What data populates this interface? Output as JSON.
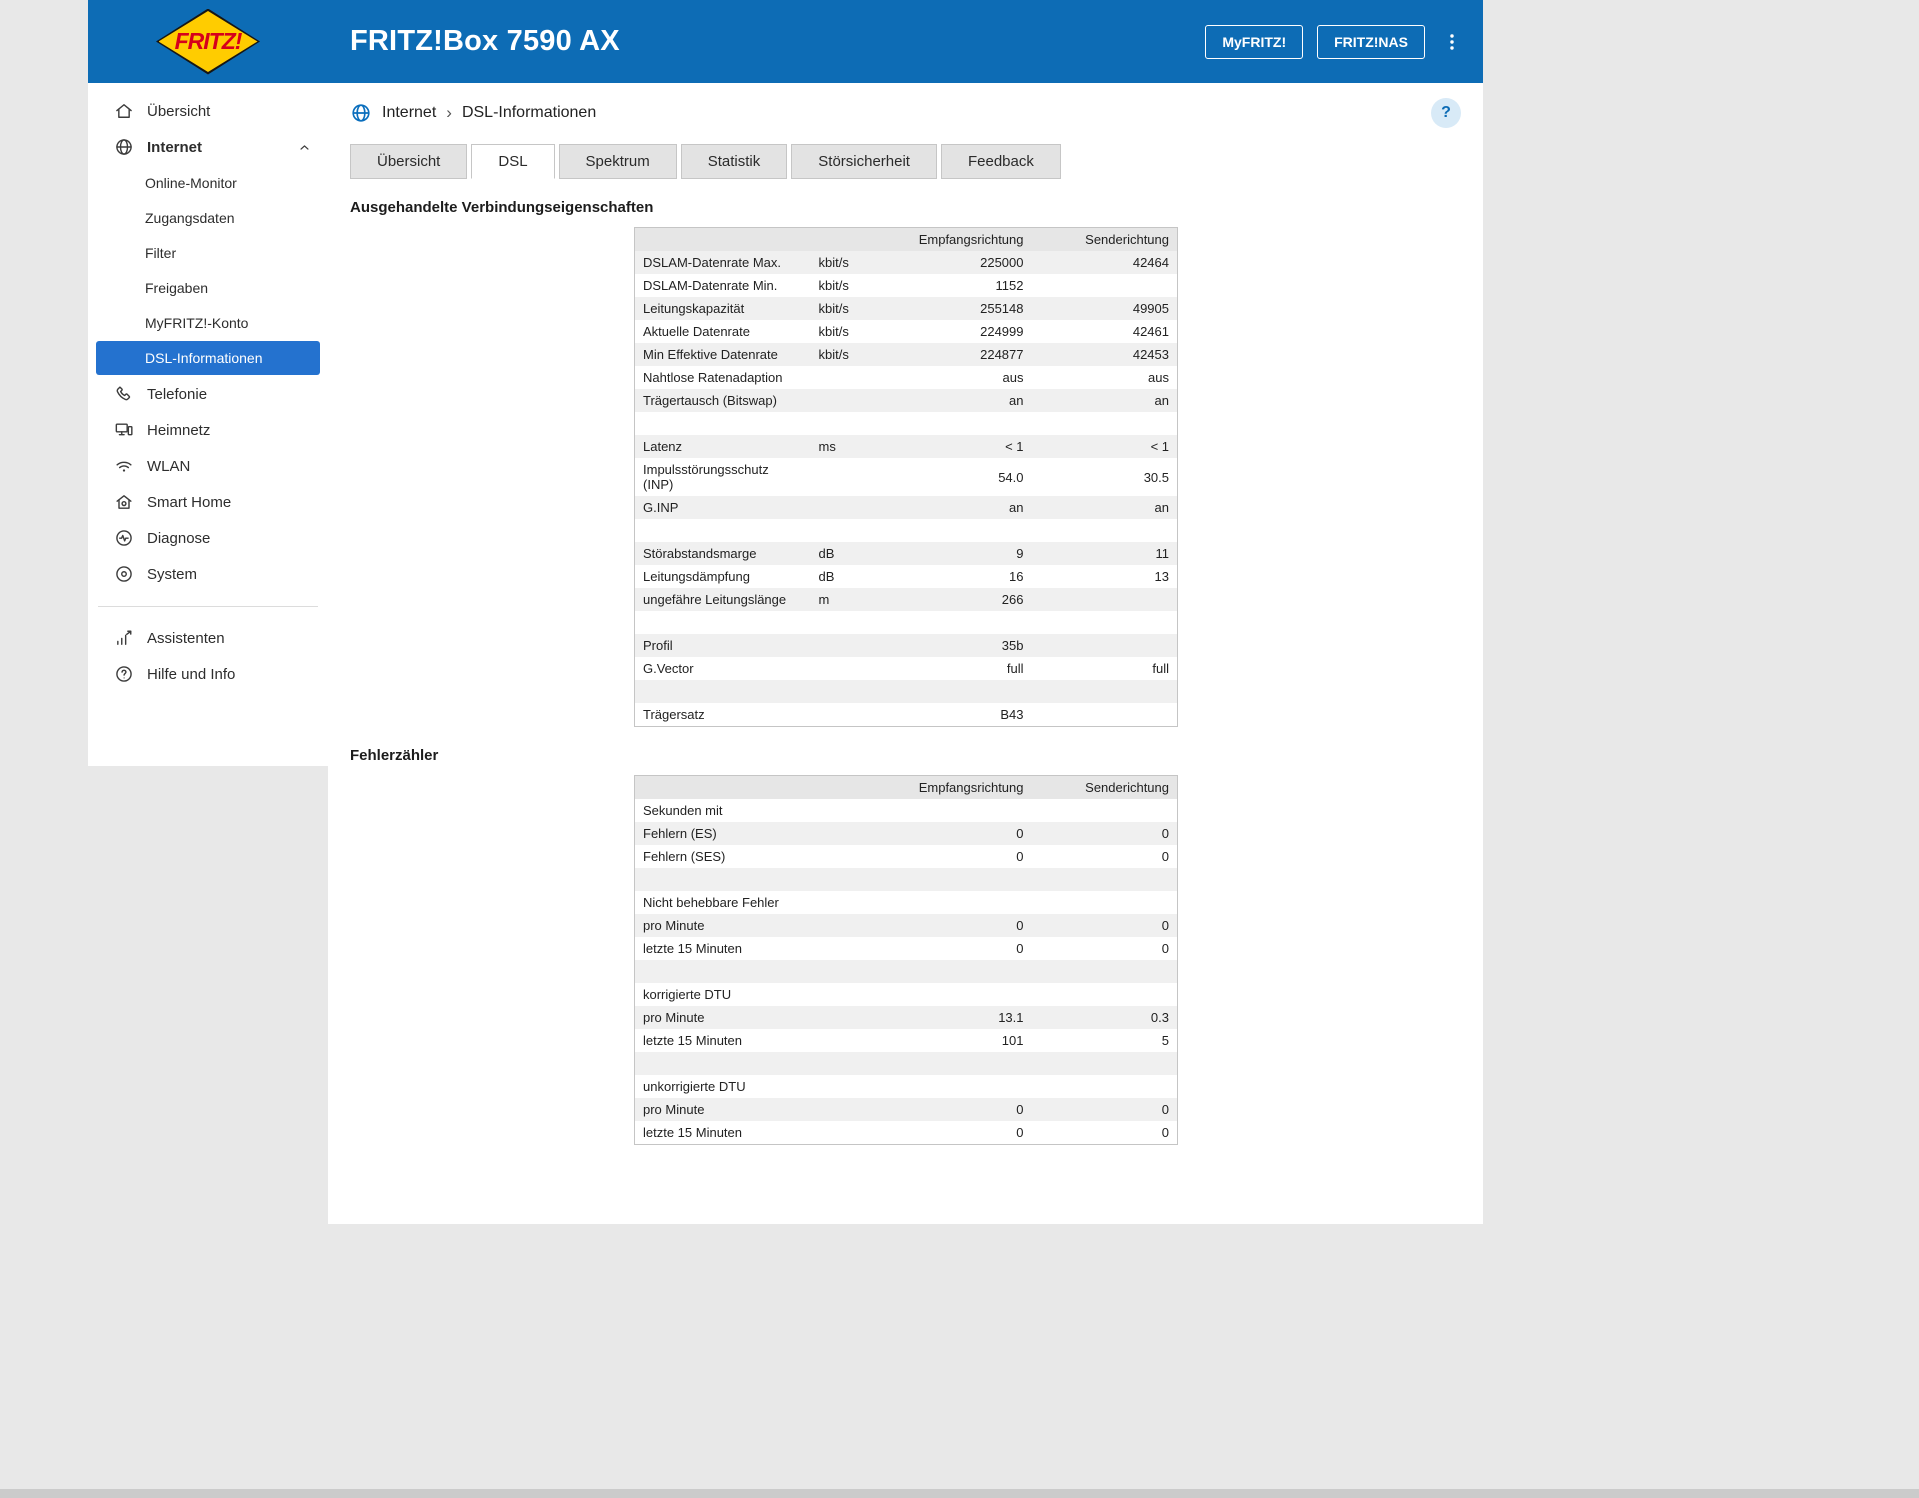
{
  "header": {
    "logo_text": "FRITZ!",
    "title": "FRITZ!Box 7590 AX",
    "actions": [
      {
        "label": "MyFRITZ!"
      },
      {
        "label": "FRITZ!NAS"
      }
    ],
    "menu_icon": "kebab-menu-icon"
  },
  "sidebar": {
    "items": [
      {
        "label": "Übersicht",
        "icon": "home-icon"
      },
      {
        "label": "Internet",
        "icon": "globe-icon",
        "bold": true,
        "expanded": true,
        "children": [
          {
            "label": "Online-Monitor"
          },
          {
            "label": "Zugangsdaten"
          },
          {
            "label": "Filter"
          },
          {
            "label": "Freigaben"
          },
          {
            "label": "MyFRITZ!-Konto"
          },
          {
            "label": "DSL-Informationen",
            "selected": true
          }
        ]
      },
      {
        "label": "Telefonie",
        "icon": "phone-icon"
      },
      {
        "label": "Heimnetz",
        "icon": "devices-icon"
      },
      {
        "label": "WLAN",
        "icon": "wifi-icon"
      },
      {
        "label": "Smart Home",
        "icon": "smart-home-icon"
      },
      {
        "label": "Diagnose",
        "icon": "diagnose-icon"
      },
      {
        "label": "System",
        "icon": "system-icon"
      },
      {
        "divider": true
      },
      {
        "label": "Assistenten",
        "icon": "assistant-icon"
      },
      {
        "label": "Hilfe und Info",
        "icon": "help-icon"
      }
    ]
  },
  "breadcrumb": {
    "icon": "globe-blue-icon",
    "items": [
      "Internet",
      "DSL-Informationen"
    ],
    "separator": "›",
    "help_text": "?"
  },
  "tabs": {
    "active": "DSL",
    "items": [
      "Übersicht",
      "DSL",
      "Spektrum",
      "Statistik",
      "Störsicherheit",
      "Feedback"
    ]
  },
  "connection_section": {
    "title": "Ausgehandelte Verbindungseigenschaften",
    "columns": {
      "rx": "Empfangsrichtung",
      "tx": "Senderichtung"
    },
    "rows": [
      {
        "label": "DSLAM-Datenrate Max.",
        "unit": "kbit/s",
        "rx": "225000",
        "tx": "42464"
      },
      {
        "label": "DSLAM-Datenrate Min.",
        "unit": "kbit/s",
        "rx": "1152",
        "tx": ""
      },
      {
        "label": "Leitungskapazität",
        "unit": "kbit/s",
        "rx": "255148",
        "tx": "49905"
      },
      {
        "label": "Aktuelle Datenrate",
        "unit": "kbit/s",
        "rx": "224999",
        "tx": "42461"
      },
      {
        "label": "Min Effektive Datenrate",
        "unit": "kbit/s",
        "rx": "224877",
        "tx": "42453"
      },
      {
        "label": "Nahtlose Ratenadaption",
        "unit": "",
        "rx": "aus",
        "tx": "aus"
      },
      {
        "label": "Trägertausch (Bitswap)",
        "unit": "",
        "rx": "an",
        "tx": "an"
      },
      {
        "spacer": true
      },
      {
        "label": "Latenz",
        "unit": "ms",
        "rx": "< 1",
        "tx": "< 1"
      },
      {
        "label": "Impulsstörungsschutz (INP)",
        "unit": "",
        "rx": "54.0",
        "tx": "30.5"
      },
      {
        "label": "G.INP",
        "unit": "",
        "rx": "an",
        "tx": "an"
      },
      {
        "spacer": true
      },
      {
        "label": "Störabstandsmarge",
        "unit": "dB",
        "rx": "9",
        "tx": "11"
      },
      {
        "label": "Leitungsdämpfung",
        "unit": "dB",
        "rx": "16",
        "tx": "13"
      },
      {
        "label": "ungefähre Leitungslänge",
        "unit": "m",
        "rx": "266",
        "tx": ""
      },
      {
        "spacer": true
      },
      {
        "label": "Profil",
        "unit": "",
        "rx": "35b",
        "tx": ""
      },
      {
        "label": "G.Vector",
        "unit": "",
        "rx": "full",
        "tx": "full"
      },
      {
        "spacer": true
      },
      {
        "label": "Trägersatz",
        "unit": "",
        "rx": "B43",
        "tx": ""
      }
    ]
  },
  "error_section": {
    "title": "Fehlerzähler",
    "columns": {
      "rx": "Empfangsrichtung",
      "tx": "Senderichtung"
    },
    "rows": [
      {
        "label": "Sekunden mit",
        "group": true,
        "rx": "",
        "tx": ""
      },
      {
        "label": "Fehlern (ES)",
        "rx": "0",
        "tx": "0"
      },
      {
        "label": "Fehlern (SES)",
        "rx": "0",
        "tx": "0"
      },
      {
        "spacer": true
      },
      {
        "label": "Nicht behebbare Fehler",
        "group": true,
        "rx": "",
        "tx": ""
      },
      {
        "label": "pro Minute",
        "rx": "0",
        "tx": "0"
      },
      {
        "label": "letzte 15 Minuten",
        "rx": "0",
        "tx": "0"
      },
      {
        "spacer": true
      },
      {
        "label": "korrigierte DTU",
        "group": true,
        "rx": "",
        "tx": ""
      },
      {
        "label": "pro Minute",
        "rx": "13.1",
        "tx": "0.3"
      },
      {
        "label": "letzte 15 Minuten",
        "rx": "101",
        "tx": "5"
      },
      {
        "spacer": true
      },
      {
        "label": "unkorrigierte DTU",
        "group": true,
        "rx": "",
        "tx": ""
      },
      {
        "label": "pro Minute",
        "rx": "0",
        "tx": "0"
      },
      {
        "label": "letzte 15 Minuten",
        "rx": "0",
        "tx": "0"
      }
    ]
  }
}
